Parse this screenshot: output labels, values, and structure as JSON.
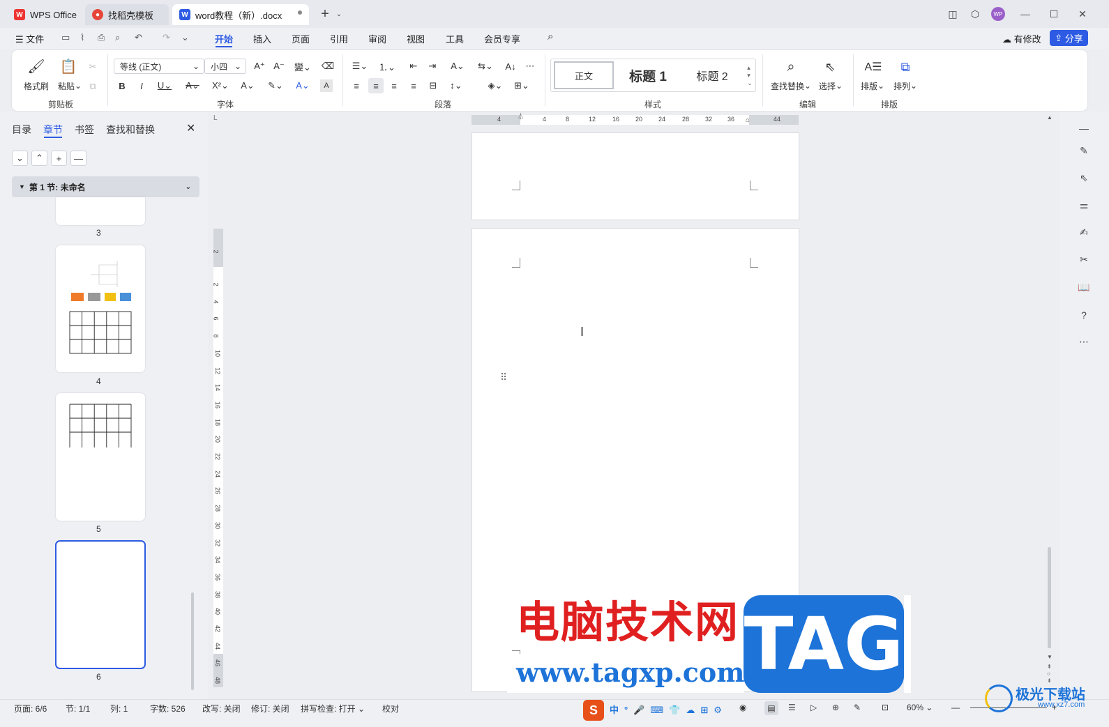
{
  "titlebar": {
    "tabs": [
      {
        "label": "WPS Office",
        "icon": "wps-logo-icon"
      },
      {
        "label": "找稻壳模板",
        "icon": "docer-icon"
      },
      {
        "label": "word教程（新）.docx",
        "icon": "word-doc-icon",
        "active": true
      }
    ],
    "avatar": "WP"
  },
  "menubar": {
    "file": "文件",
    "tabs": [
      "开始",
      "插入",
      "页面",
      "引用",
      "审阅",
      "视图",
      "工具",
      "会员专享"
    ],
    "active_tab": "开始",
    "modified": "有修改",
    "share": "分享"
  },
  "ribbon": {
    "clipboard": {
      "format_painter": "格式刷",
      "paste": "粘贴",
      "label": "剪贴板"
    },
    "font": {
      "family": "等线 (正文)",
      "size": "小四",
      "label": "字体"
    },
    "paragraph": {
      "label": "段落"
    },
    "styles": {
      "normal": "正文",
      "heading1": "标题 1",
      "heading2": "标题 2",
      "label": "样式"
    },
    "edit": {
      "find_replace": "查找替换",
      "select": "选择",
      "label": "编辑"
    },
    "layout": {
      "arrange_text": "排版",
      "arrange": "排列",
      "label": "排版"
    }
  },
  "leftpane": {
    "tabs": [
      "目录",
      "章节",
      "书签",
      "查找和替换"
    ],
    "active_tab": "章节",
    "section": "第 1 节: 未命名",
    "pages": [
      "3",
      "4",
      "5",
      "6"
    ]
  },
  "ruler": {
    "h_ticks": [
      "4",
      "4",
      "8",
      "12",
      "16",
      "20",
      "24",
      "28",
      "32",
      "36",
      "44"
    ],
    "v_ticks": [
      "2",
      "2",
      "4",
      "6",
      "8",
      "10",
      "12",
      "14",
      "16",
      "18",
      "20",
      "22",
      "24",
      "26",
      "28",
      "30",
      "32",
      "34",
      "36",
      "38",
      "40",
      "42",
      "44",
      "46",
      "48"
    ]
  },
  "watermark": {
    "cn": "电脑技术网",
    "url": "www.tagxp.com",
    "tag": "TAG",
    "brand": "极光下载站",
    "brand_url": "www.xz7.com"
  },
  "statusbar": {
    "page": "页面: 6/6",
    "section": "节: 1/1",
    "column": "列: 1",
    "words": "字数: 526",
    "revise_mode": "改写: 关闭",
    "track": "修订: 关闭",
    "spell": "拼写检查: 打开",
    "proof": "校对",
    "zoom": "60%"
  },
  "colors": {
    "accent": "#2d5be3",
    "watermark_red": "#e02020",
    "watermark_blue": "#1d73d8"
  }
}
